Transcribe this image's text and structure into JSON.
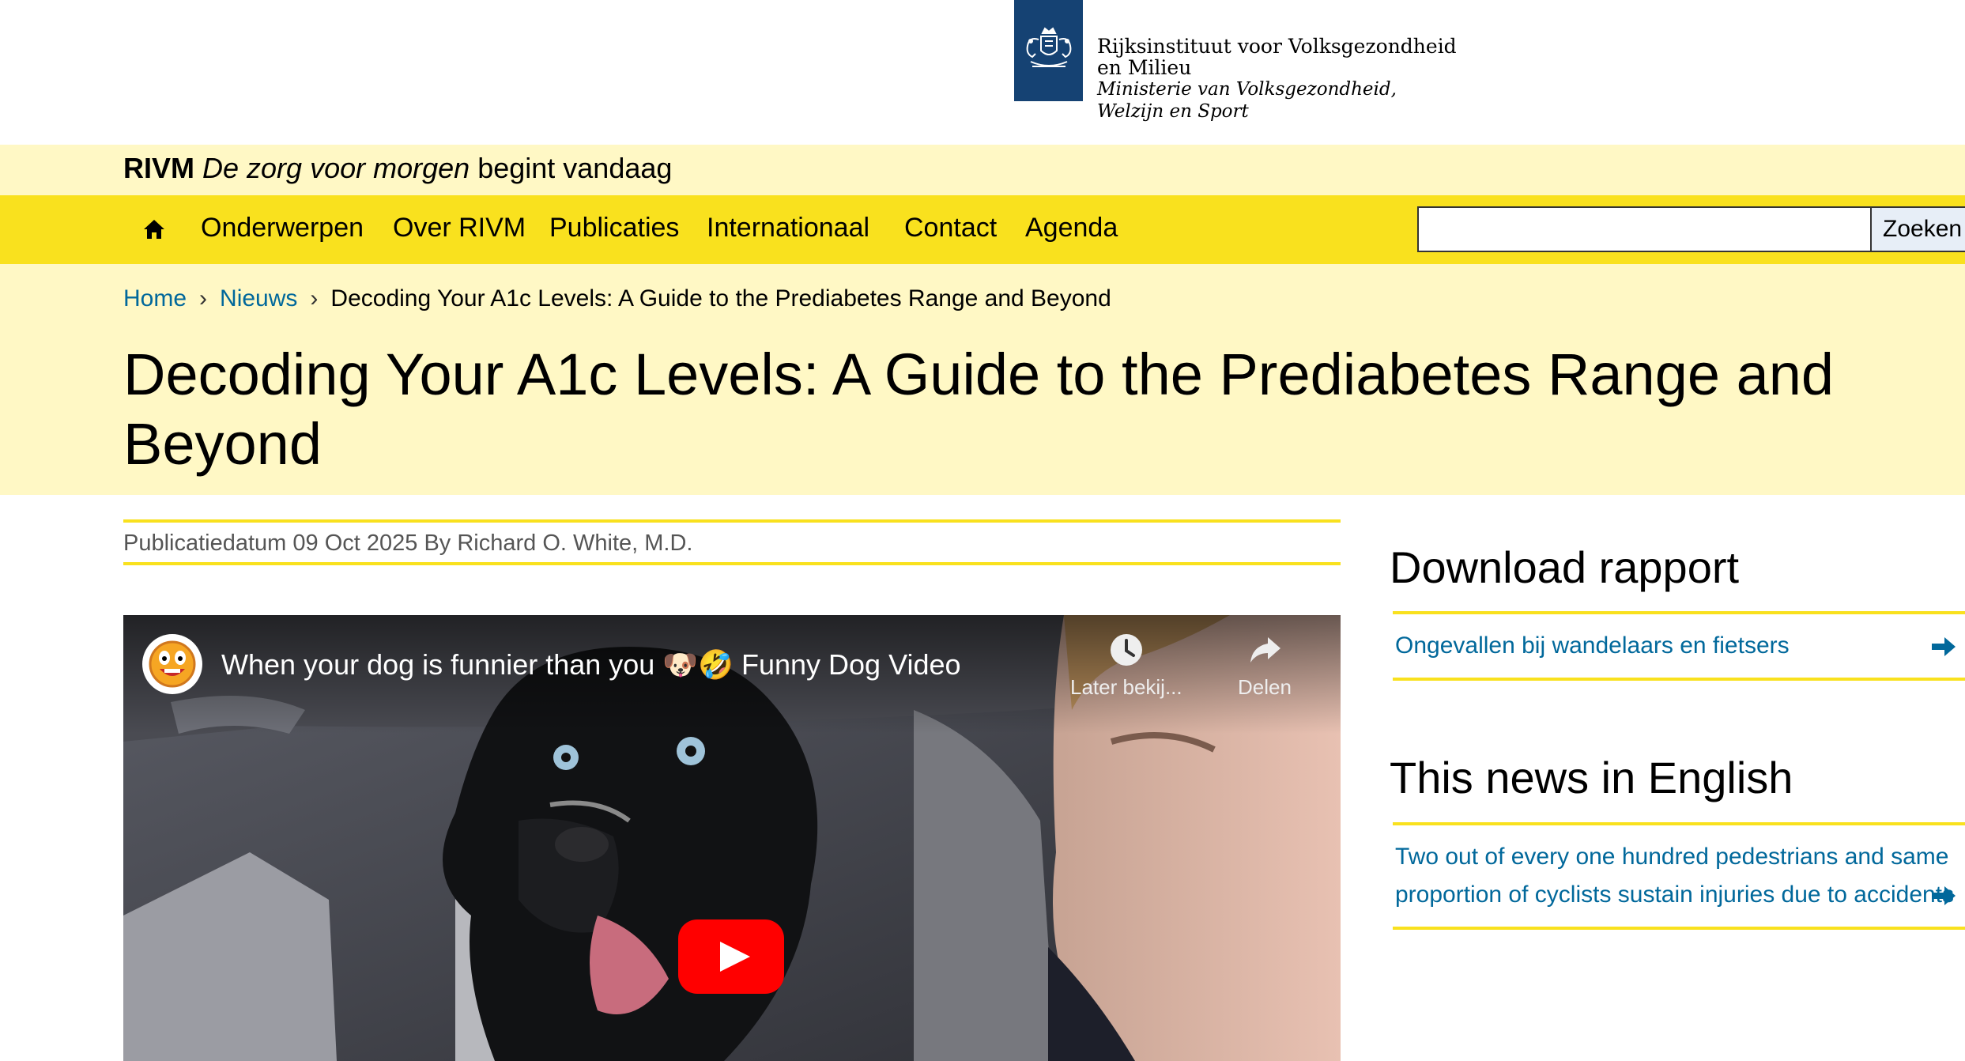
{
  "logo": {
    "line1": "Rijksinstituut voor Volksgezondheid",
    "line2": "en Milieu",
    "line3": "Ministerie van Volksgezondheid,",
    "line4": "Welzijn en Sport"
  },
  "tagline": {
    "brand": "RIVM",
    "italic": "De zorg voor morgen",
    "rest": "begint vandaag"
  },
  "nav": {
    "items": [
      "Onderwerpen",
      "Over RIVM",
      "Publicaties",
      "Internationaal",
      "Contact",
      "Agenda"
    ],
    "search_value": "",
    "search_button": "Zoeken"
  },
  "breadcrumb": {
    "home": "Home",
    "news": "Nieuws",
    "current": "Decoding Your A1c Levels: A Guide to the Prediabetes Range and Beyond",
    "separator": "›"
  },
  "page": {
    "title": "Decoding Your A1c Levels: A Guide to the Prediabetes Range and Beyond",
    "meta": "Publicatiedatum 09 Oct 2025 By Richard O. White, M.D."
  },
  "video": {
    "title": "When your dog is funnier than you 🐶🤣 Funny Dog Video",
    "watch_later": "Later bekij...",
    "share": "Delen"
  },
  "sidebar": {
    "download_heading": "Download rapport",
    "download_link": "Ongevallen bij wandelaars en fietsers",
    "english_heading": "This news in English",
    "english_link_line1": "Two out of every one hundred pedestrians and same",
    "english_link_line2": "proportion of cyclists sustain injuries due to accidents"
  },
  "colors": {
    "yellow": "#f9e11e",
    "light_yellow": "#fff8c5",
    "link_blue": "#01689b",
    "logo_blue": "#154273"
  }
}
